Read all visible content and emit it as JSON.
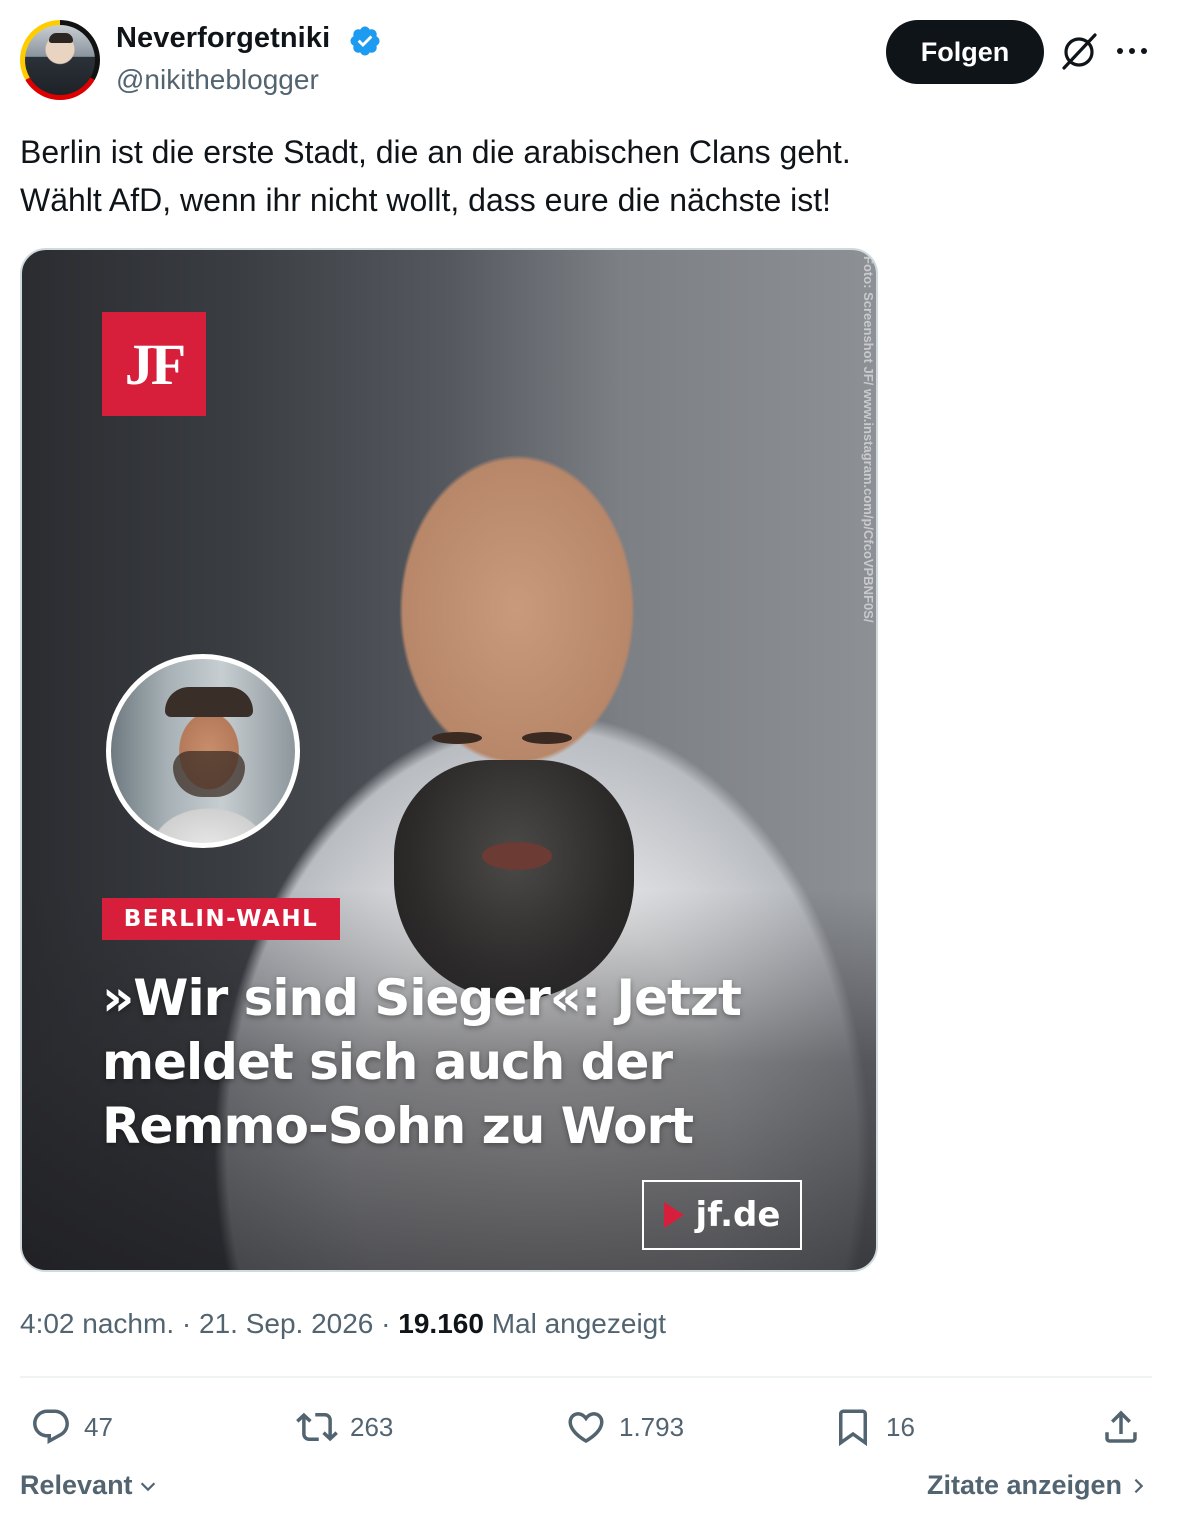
{
  "author": {
    "display_name": "Neverforgetniki",
    "handle": "@nikitheblogger",
    "verified": true
  },
  "header": {
    "follow_label": "Folgen"
  },
  "tweet": {
    "lines": [
      "Berlin ist die erste Stadt, die an die arabischen Clans geht.",
      "Wählt AfD, wenn ihr nicht wollt, dass eure die nächste ist!"
    ]
  },
  "media": {
    "logo_text": "JF",
    "badge": "BERLIN-WAHL",
    "headline_lines": [
      "»Wir sind Sieger«: Jetzt",
      "meldet sich auch der",
      "Remmo-Sohn zu Wort"
    ],
    "site_label": "jf.de",
    "photo_credit": "Foto: Screenshot JF/ www.instagram.com/p/CfcoVPBNF0S/"
  },
  "meta": {
    "time": "4:02 nachm.",
    "date": "21. Sep. 2026",
    "views_count": "19.160",
    "views_label": "Mal angezeigt"
  },
  "actions": {
    "replies": "47",
    "reposts": "263",
    "likes": "1.793",
    "bookmarks": "16"
  },
  "footer": {
    "sort_label": "Relevant",
    "quotes_label": "Zitate anzeigen"
  },
  "colors": {
    "accent_verified": "#1d9bf0",
    "jf_red": "#d71f3b",
    "text_primary": "#0f1419",
    "text_secondary": "#536471"
  }
}
